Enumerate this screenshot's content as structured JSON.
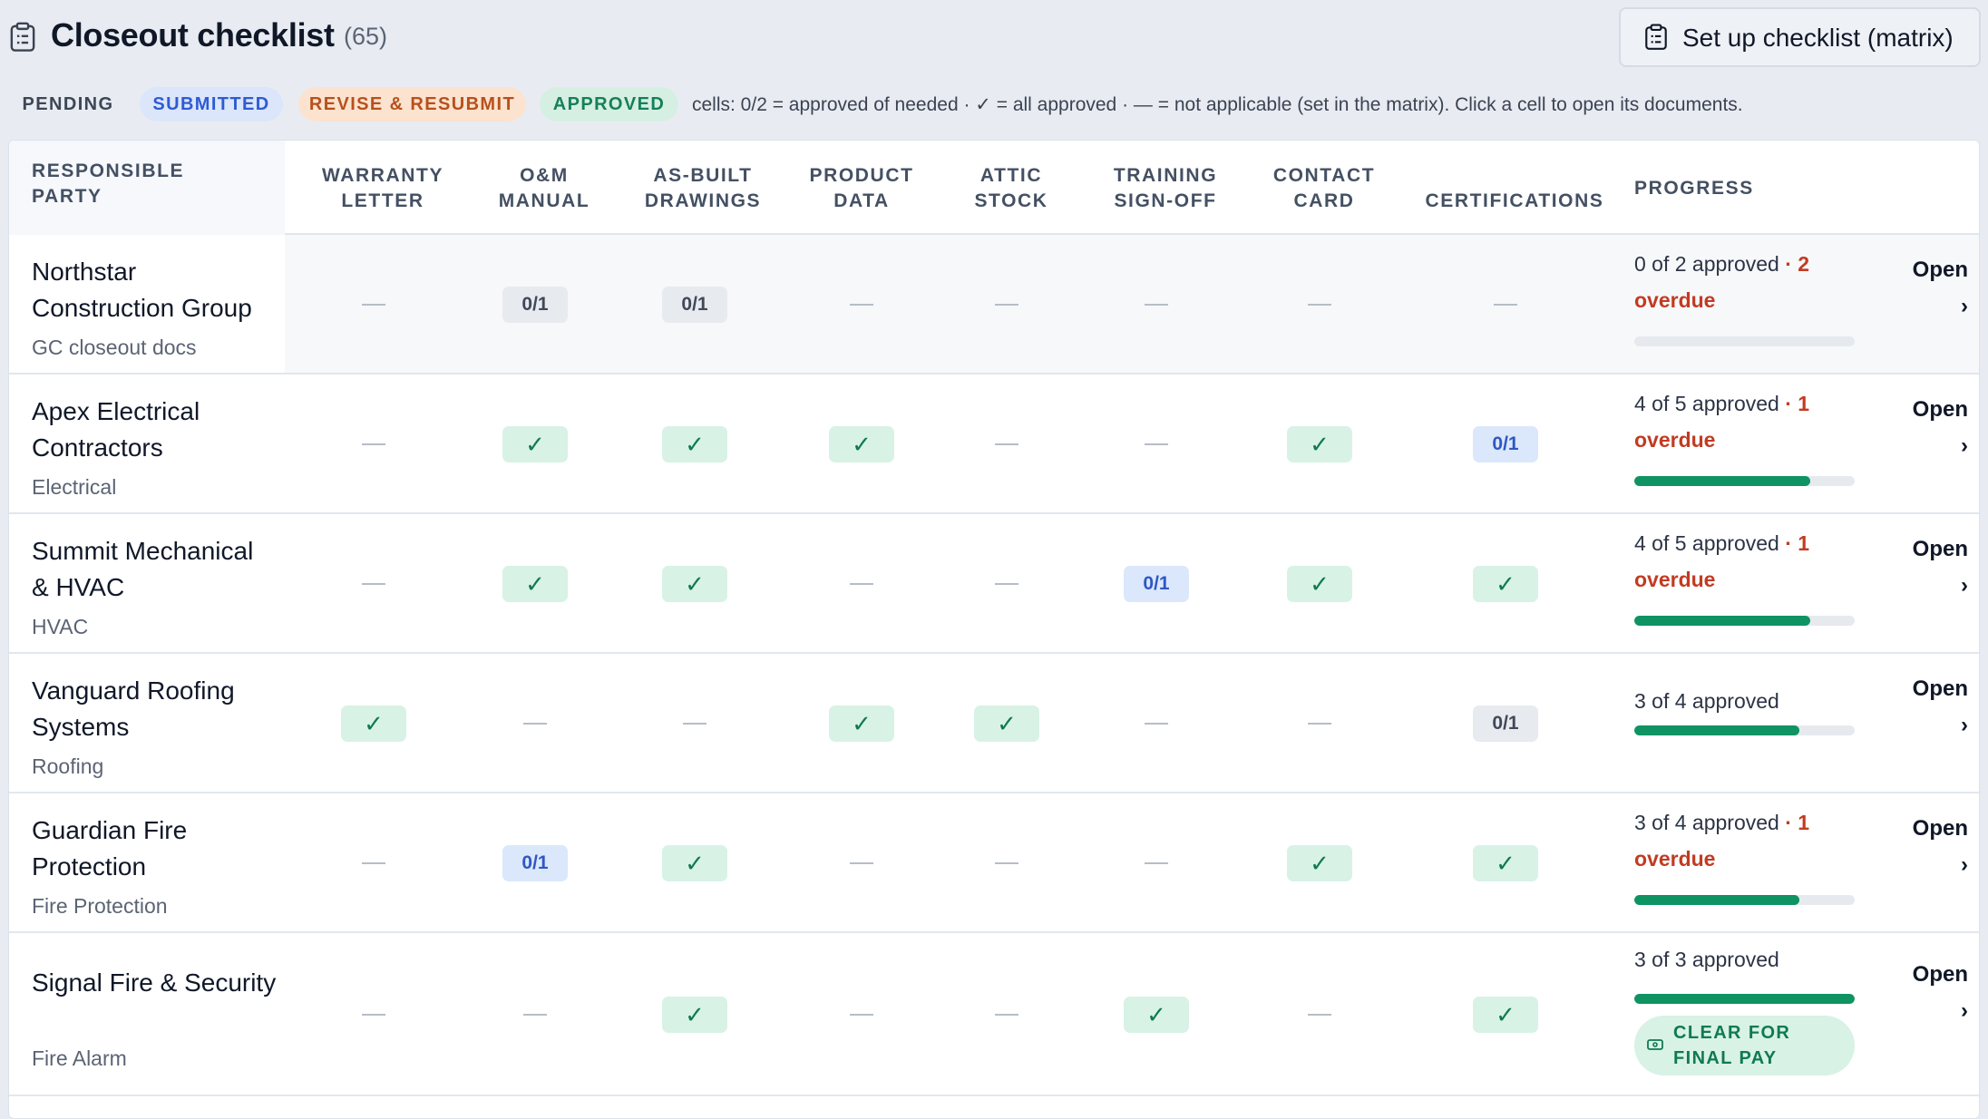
{
  "header": {
    "title": "Closeout checklist",
    "count": "(65)",
    "setup_button": "Set up checklist (matrix)"
  },
  "legend": {
    "pending": "PENDING",
    "submitted": "SUBMITTED",
    "revise": "REVISE & RESUBMIT",
    "approved": "APPROVED",
    "note": "cells: 0/2 = approved of needed · ✓ = all approved · — = not applicable (set in the matrix). Click a cell to open its documents."
  },
  "columns": {
    "party": "RESPONSIBLE PARTY",
    "c1": "WARRANTY LETTER",
    "c2": "O&M MANUAL",
    "c3": "AS-BUILT DRAWINGS",
    "c4": "PRODUCT DATA",
    "c5": "ATTIC STOCK",
    "c6": "TRAINING SIGN-OFF",
    "c7": "CONTACT CARD",
    "c8": "CERTIFICATIONS",
    "progress": "PROGRESS"
  },
  "rows": [
    {
      "name": "Northstar Construction Group",
      "trade": "GC closeout docs",
      "cells": [
        "na",
        "pend:0/1",
        "pend:0/1",
        "na",
        "na",
        "na",
        "na",
        "na"
      ],
      "progress_text": "0 of 2 approved",
      "overdue": "· 2 overdue",
      "progress": 0,
      "open": "Open ›"
    },
    {
      "name": "Apex Electrical Contractors",
      "trade": "Electrical",
      "cells": [
        "na",
        "ok",
        "ok",
        "ok",
        "na",
        "na",
        "ok",
        "sub:0/1"
      ],
      "progress_text": "4 of 5 approved",
      "overdue": "· 1 overdue",
      "progress": 0.8,
      "open": "Open ›"
    },
    {
      "name": "Summit Mechanical & HVAC",
      "trade": "HVAC",
      "cells": [
        "na",
        "ok",
        "ok",
        "na",
        "na",
        "sub:0/1",
        "ok",
        "ok"
      ],
      "progress_text": "4 of 5 approved",
      "overdue": "· 1 overdue",
      "progress": 0.8,
      "open": "Open ›"
    },
    {
      "name": "Vanguard Roofing Systems",
      "trade": "Roofing",
      "cells": [
        "ok",
        "na",
        "na",
        "ok",
        "ok",
        "na",
        "na",
        "pend:0/1"
      ],
      "progress_text": "3 of 4 approved",
      "overdue": "",
      "progress": 0.75,
      "open": "Open ›"
    },
    {
      "name": "Guardian Fire Protection",
      "trade": "Fire Protection",
      "cells": [
        "na",
        "sub:0/1",
        "ok",
        "na",
        "na",
        "na",
        "ok",
        "ok"
      ],
      "progress_text": "3 of 4 approved",
      "overdue": "· 1 overdue",
      "progress": 0.75,
      "open": "Open ›"
    },
    {
      "name": "Signal Fire & Security",
      "trade": "Fire Alarm",
      "cells": [
        "na",
        "na",
        "ok",
        "na",
        "na",
        "ok",
        "na",
        "ok"
      ],
      "progress_text": "3 of 3 approved",
      "overdue": "",
      "progress": 1,
      "open": "Open ›",
      "final_pay": "CLEAR FOR FINAL PAY"
    }
  ],
  "colors": {
    "approved_bg": "#d8f2e6",
    "approved_fg": "#107a52",
    "submitted_bg": "#dbe7fb",
    "submitted_fg": "#2f57c4",
    "revise_bg": "#fbe3cf",
    "revise_fg": "#b8501c",
    "overdue": "#c23b22",
    "progress_fill": "#0f9362"
  }
}
